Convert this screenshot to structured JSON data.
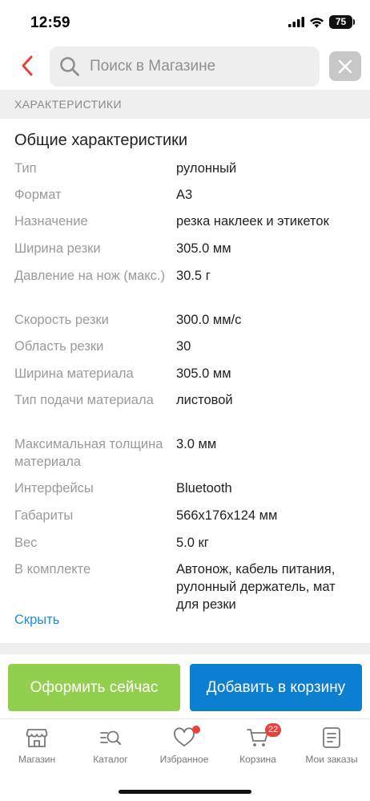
{
  "status_bar": {
    "time": "12:59",
    "battery": "75"
  },
  "search": {
    "placeholder": "Поиск в Магазине"
  },
  "section_header": "ХАРАКТЕРИСТИКИ",
  "specs": {
    "group_title": "Общие характеристики",
    "rows": [
      {
        "label": "Тип",
        "value": "рулонный"
      },
      {
        "label": "Формат",
        "value": "A3"
      },
      {
        "label": "Назначение",
        "value": "резка наклеек и этикеток"
      },
      {
        "label": "Ширина резки",
        "value": "305.0 мм"
      },
      {
        "label": "Давление на нож (макс.)",
        "value": "30.5 г"
      },
      {
        "label": "Скорость резки",
        "value": "300.0 мм/с"
      },
      {
        "label": "Область резки",
        "value": "30"
      },
      {
        "label": "Ширина материала",
        "value": "305.0 мм"
      },
      {
        "label": "Тип подачи материала",
        "value": "листовой"
      },
      {
        "label": "Максимальная толщина материала",
        "value": "3.0 мм"
      },
      {
        "label": "Интерфейсы",
        "value": "Bluetooth"
      },
      {
        "label": "Габариты",
        "value": "566x176x124 мм"
      },
      {
        "label": "Вес",
        "value": "5.0 кг"
      },
      {
        "label": "В комплекте",
        "value": "Автонож, кабель питания, рулонный держатель, мат для резки"
      }
    ],
    "hide_label": "Скрыть"
  },
  "actions": {
    "order_label": "Оформить сейчас",
    "add_to_cart_label": "Добавить в корзину",
    "order_color": "#93cf4e",
    "cart_color": "#0d7fd0"
  },
  "tab_bar": {
    "items": [
      {
        "label": "Магазин",
        "icon": "store-icon"
      },
      {
        "label": "Каталог",
        "icon": "catalog-search-icon"
      },
      {
        "label": "Избранное",
        "icon": "heart-icon"
      },
      {
        "label": "Корзина",
        "icon": "cart-icon",
        "badge": "22"
      },
      {
        "label": "Мои заказы",
        "icon": "orders-icon"
      }
    ]
  },
  "accent_color": "#e8413a"
}
